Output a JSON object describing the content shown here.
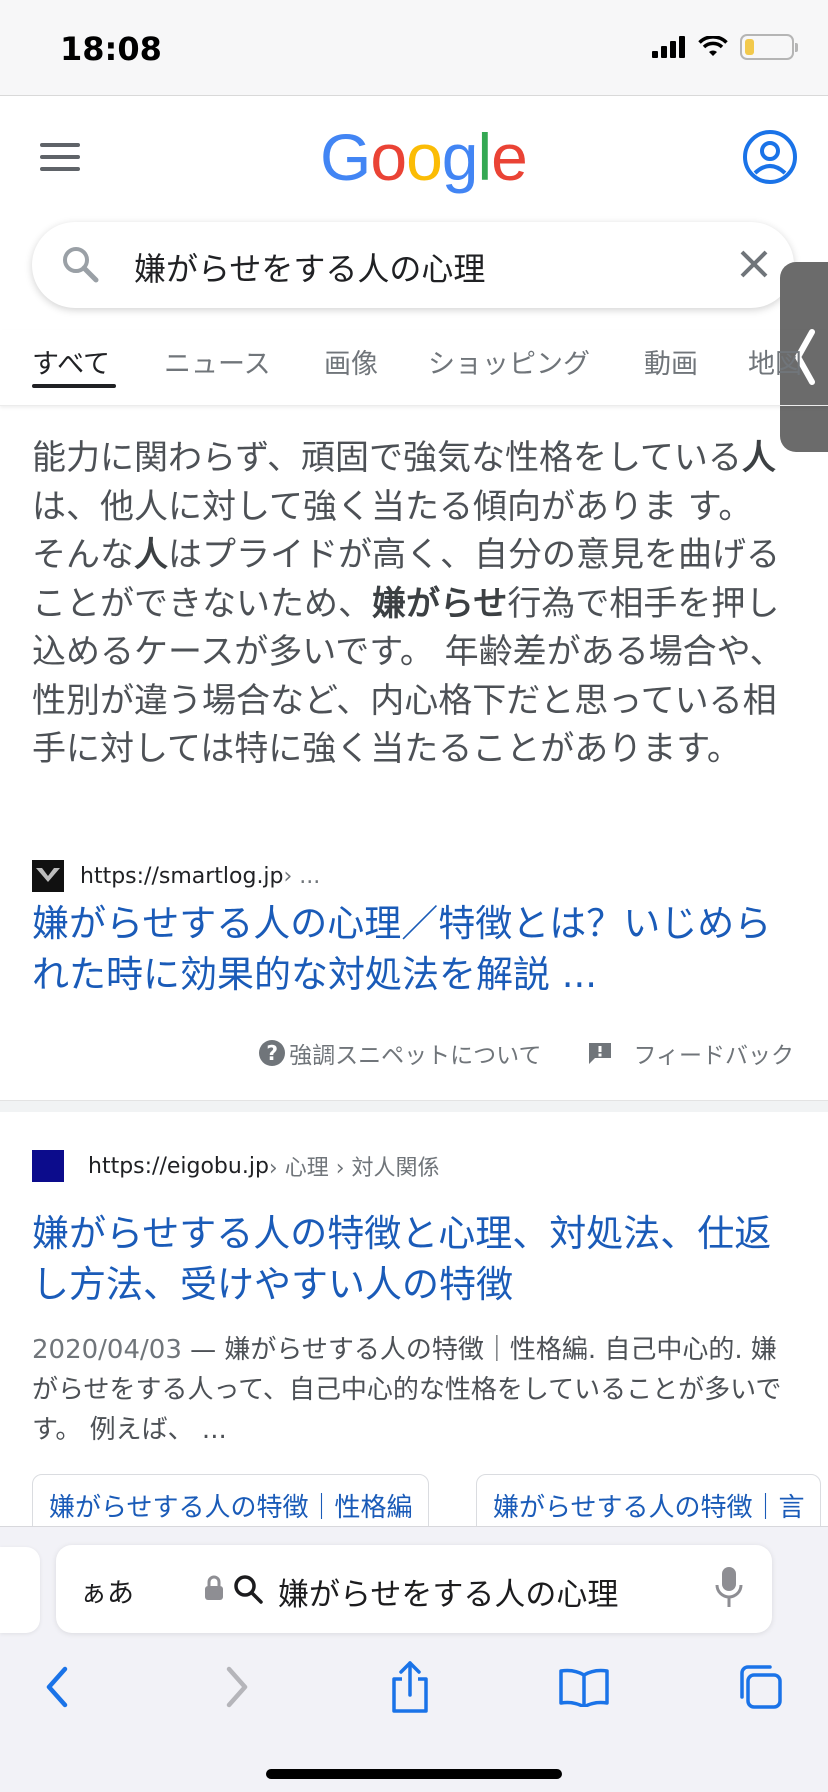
{
  "status_bar": {
    "time": "18:08",
    "battery_level": 0.2,
    "battery_color": "#f2c94c"
  },
  "header": {
    "logo_letters": [
      {
        "char": "G",
        "color": "#4285f4"
      },
      {
        "char": "o",
        "color": "#ea4335"
      },
      {
        "char": "o",
        "color": "#fbbc05"
      },
      {
        "char": "g",
        "color": "#4285f4"
      },
      {
        "char": "l",
        "color": "#34a853"
      },
      {
        "char": "e",
        "color": "#ea4335"
      }
    ],
    "accent": "#1a73e8"
  },
  "search": {
    "query": "嫌がらせをする人の心理"
  },
  "tabs": [
    {
      "label": "すべて",
      "active": true
    },
    {
      "label": "ニュース",
      "active": false
    },
    {
      "label": "画像",
      "active": false
    },
    {
      "label": "ショッピング",
      "active": false
    },
    {
      "label": "動画",
      "active": false
    },
    {
      "label": "地図",
      "active": false
    }
  ],
  "featured_snippet": {
    "segments": [
      {
        "text": "能力に関わらず、頑固で強気な性格をしている",
        "bold": false
      },
      {
        "text": "人",
        "bold": true
      },
      {
        "text": "は、他人に対して強く当たる傾向がありま す。 そんな",
        "bold": false
      },
      {
        "text": "人",
        "bold": true
      },
      {
        "text": "はプライドが高く、自分の意見を曲げることができないため、",
        "bold": false
      },
      {
        "text": "嫌がらせ",
        "bold": true
      },
      {
        "text": "行為で相手を押し込めるケースが多いです。 年齢差がある場合や、性別が違う場合など、内心格下だと思っている相手に対しては特に強く当たることがあります。",
        "bold": false
      }
    ],
    "source_url": "https://smartlog.jp",
    "source_crumb": " › ...",
    "title": "嫌がらせする人の心理／特徴とは？いじめられた時に効果的な対処法を解説 ...",
    "about_label": "強調スニペットについて",
    "feedback_label": "フィードバック"
  },
  "result2": {
    "source_url": "https://eigobu.jp",
    "source_crumb": " › 心理 › 対人関係",
    "title": "嫌がらせする人の特徴と心理、対処法、仕返し方法、受けやすい人の特徴",
    "date": "2020/04/03",
    "description": " — 嫌がらせする人の特徴｜性格編. 自己中心的. 嫌がらせをする人って、自己中心的な性格をしていることが多いです。 例えば、 ...",
    "chips": [
      "嫌がらせする人の特徴｜性格編",
      "嫌がらせする人の特徴｜言"
    ]
  },
  "safari": {
    "aa_label": "ぁあ",
    "address_text": "嫌がらせをする人の心理"
  }
}
